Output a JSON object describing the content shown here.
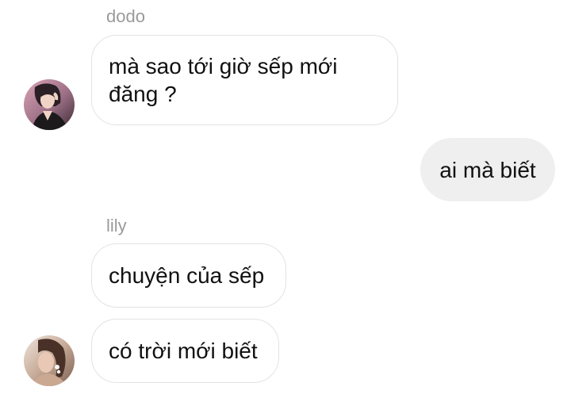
{
  "messages": [
    {
      "sender": "dodo",
      "text": "mà sao tới giờ sếp mới đăng ?",
      "direction": "incoming"
    },
    {
      "sender": "",
      "text": "ai mà biết",
      "direction": "outgoing"
    },
    {
      "sender": "lily",
      "text": "chuyện của sếp",
      "direction": "incoming"
    },
    {
      "sender": "lily",
      "text": "có trời mới biết",
      "direction": "incoming"
    }
  ],
  "colors": {
    "incoming_bubble_border": "#e3e3e3",
    "outgoing_bubble_bg": "#efefef",
    "sender_name": "#9a9a9a",
    "message_text": "#111111"
  }
}
